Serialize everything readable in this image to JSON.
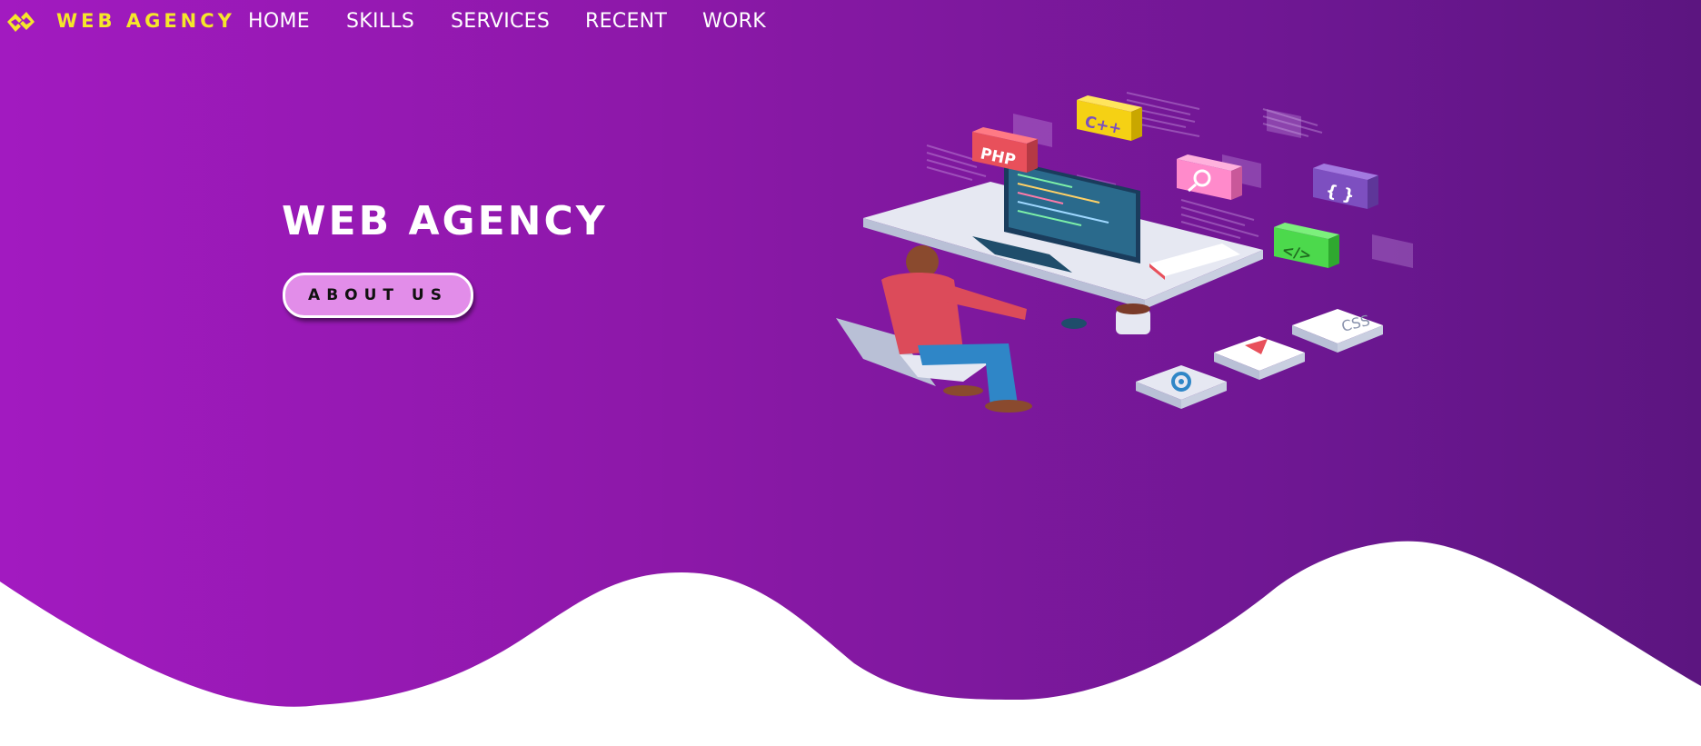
{
  "brand": {
    "name": "WEB AGENCY",
    "color": "#f5e62a"
  },
  "nav": {
    "items": [
      {
        "label": "HOME"
      },
      {
        "label": "SKILLS"
      },
      {
        "label": "SERVICES"
      },
      {
        "label": "RECENT"
      },
      {
        "label": "WORK"
      }
    ]
  },
  "hero": {
    "title": "WEB AGENCY",
    "button_label": "ABOUT US",
    "gradient_start": "#a21ac0",
    "gradient_end": "#5c1580",
    "button_color": "#e28de9"
  },
  "illustration": {
    "tiles": [
      {
        "label": "PHP",
        "color": "#e8505b"
      },
      {
        "label": "C++",
        "color": "#f5d114"
      },
      {
        "label": "{ }",
        "color": "#7d4fc0"
      },
      {
        "label": "</>",
        "color": "#4cd94c"
      },
      {
        "label": "CSS",
        "color": "#ffffff"
      }
    ]
  }
}
